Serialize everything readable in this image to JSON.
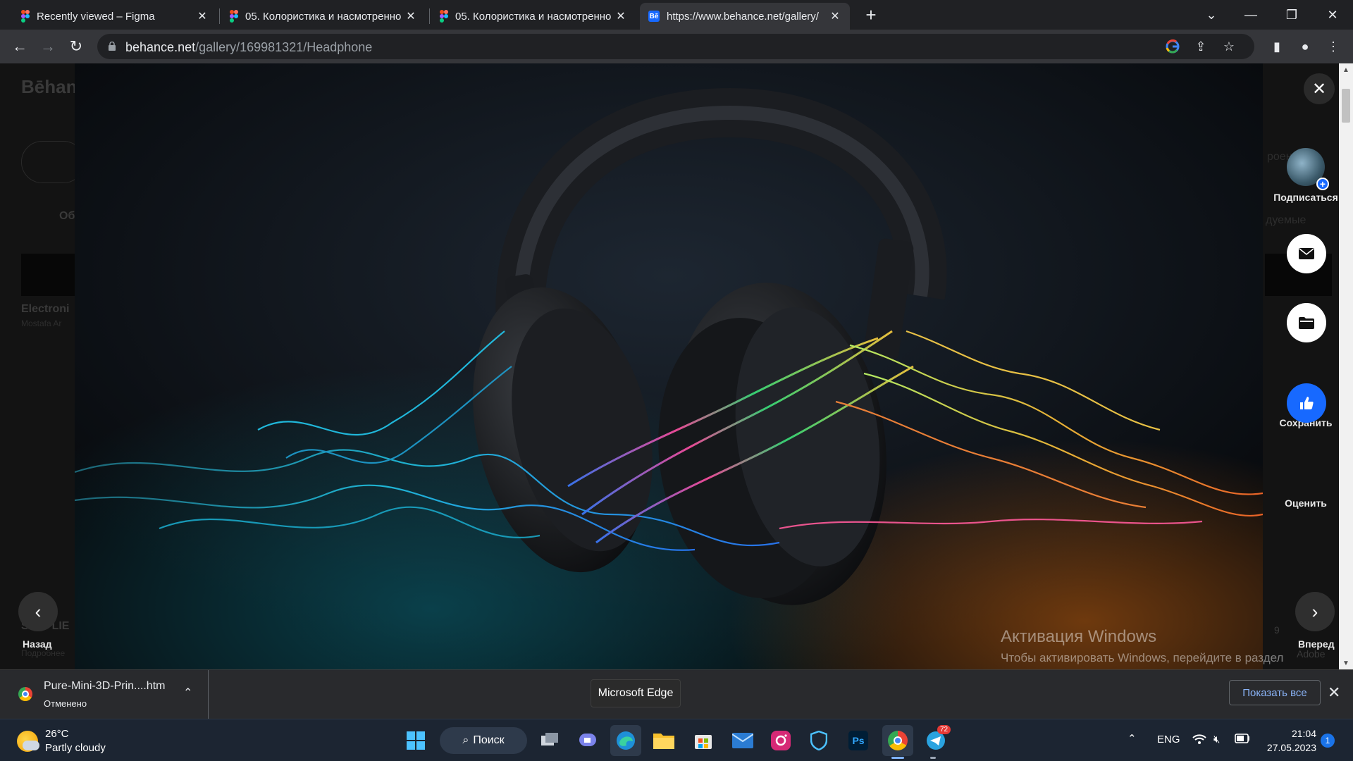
{
  "tabs": [
    {
      "title": "Recently viewed – Figma",
      "icon": "figma-icon"
    },
    {
      "title": "05. Колористика и насмотренно",
      "icon": "figma-icon"
    },
    {
      "title": "05. Колористика и насмотренно",
      "icon": "figma-icon"
    },
    {
      "title": "https://www.behance.net/gallery/",
      "icon": "behance-icon",
      "icon_text": "Bē",
      "active": true
    }
  ],
  "address": {
    "host": "behance.net",
    "path": "/gallery/169981321/Headphone"
  },
  "background": {
    "logo": "Bēhan",
    "card_title": "Electroni",
    "card_author": "Mostafa Ar",
    "bottom_title": "SUPPLIE",
    "bottom_sub": "Подробнее",
    "tab_label": "Об",
    "right_sub1": "роени",
    "right_sub2": "дуемые",
    "adobe_text": "Adobe",
    "count": "9"
  },
  "modal": {
    "close_symbol": "✕",
    "subscribe_label": "Подписаться",
    "save_label": "Сохранить",
    "rate_label": "Оценить",
    "back_label": "Назад",
    "forward_label": "Вперед",
    "subject": "Headphone"
  },
  "watermark": {
    "title": "Активация Windows",
    "sub": "Чтобы активировать Windows, перейдите в раздел \"Параметры\"."
  },
  "download": {
    "filename": "Pure-Mini-3D-Prin....htm",
    "status": "Отменено",
    "show_all": "Показать все"
  },
  "tooltip": "Microsoft Edge",
  "taskbar": {
    "temperature": "26°C",
    "condition": "Partly cloudy",
    "search_label": "Поиск",
    "language": "ENG",
    "time": "21:04",
    "date": "27.05.2023",
    "notification_count": "1",
    "telegram_badge": "72",
    "photoshop_label": "Ps"
  },
  "colors": {
    "accent": "#1769ff",
    "chrome_dark": "#202124",
    "chrome_toolbar": "#35363a",
    "taskbar": "#1c2532"
  }
}
